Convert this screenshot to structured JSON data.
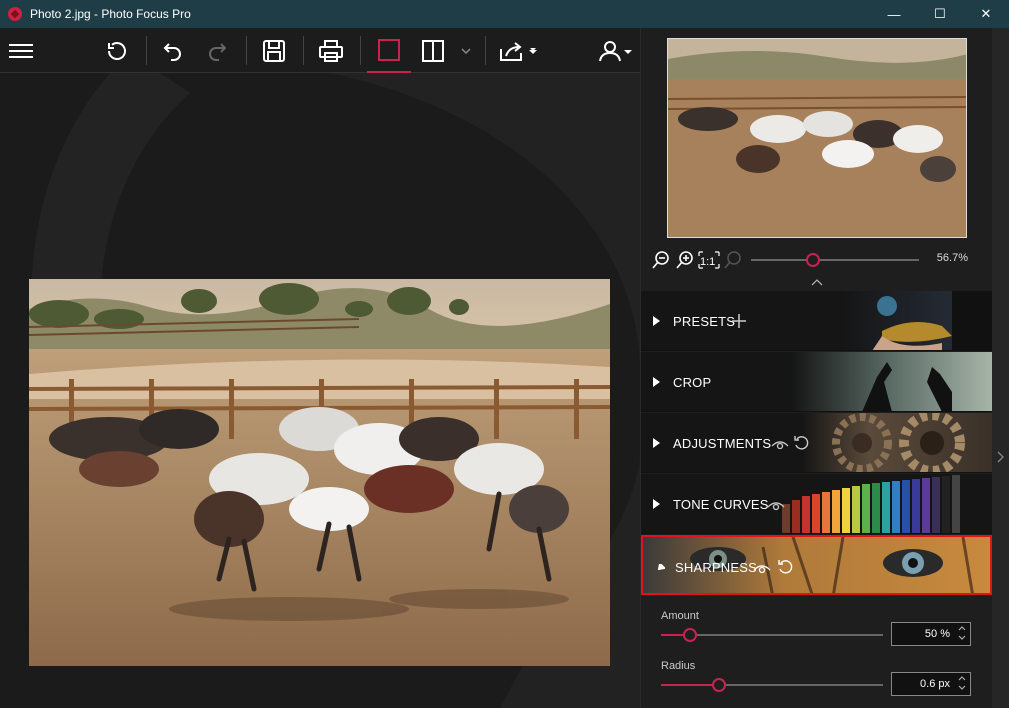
{
  "window": {
    "title": "Photo 2.jpg - Photo Focus Pro",
    "minimize": "—",
    "maximize": "☐",
    "close": "✕"
  },
  "toolbar": {
    "icons": [
      "hamburger-menu-icon",
      "undo-history-icon",
      "undo-icon",
      "redo-icon",
      "save-icon",
      "print-icon",
      "single-view-icon",
      "split-view-icon",
      "split-view-dropdown-icon",
      "share-icon",
      "user-account-icon"
    ]
  },
  "navigator": {
    "zoom_value": "56.7%",
    "zoom_level": 0.37
  },
  "sections": [
    {
      "label": "PRESETS",
      "expanded": false
    },
    {
      "label": "CROP",
      "expanded": false
    },
    {
      "label": "ADJUSTMENTS",
      "expanded": false
    },
    {
      "label": "TONE CURVES",
      "expanded": false
    },
    {
      "label": "SHARPNESS",
      "expanded": true
    }
  ],
  "sharpness": {
    "amount_label": "Amount",
    "amount_value": "50 %",
    "amount_level": 0.13,
    "radius_label": "Radius",
    "radius_value": "0.6 px",
    "radius_level": 0.26
  },
  "colors": {
    "accent": "#c8234f",
    "titlebar": "#1f3d47",
    "highlight": "#e2141a"
  }
}
